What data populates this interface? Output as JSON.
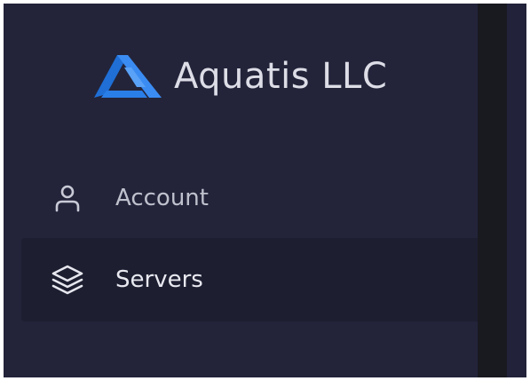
{
  "brand": {
    "name": "Aquatis LLC",
    "logo_icon": "brand-logo-icon"
  },
  "sidebar": {
    "items": [
      {
        "label": "Account",
        "icon": "user-icon",
        "active": false
      },
      {
        "label": "Servers",
        "icon": "layers-icon",
        "active": true
      }
    ]
  },
  "colors": {
    "sidebar_bg": "#23243a",
    "active_item_bg": "#1d1e30",
    "divider": "#191920",
    "logo_blue": "#2f83ee",
    "text": "#dcdde6"
  }
}
